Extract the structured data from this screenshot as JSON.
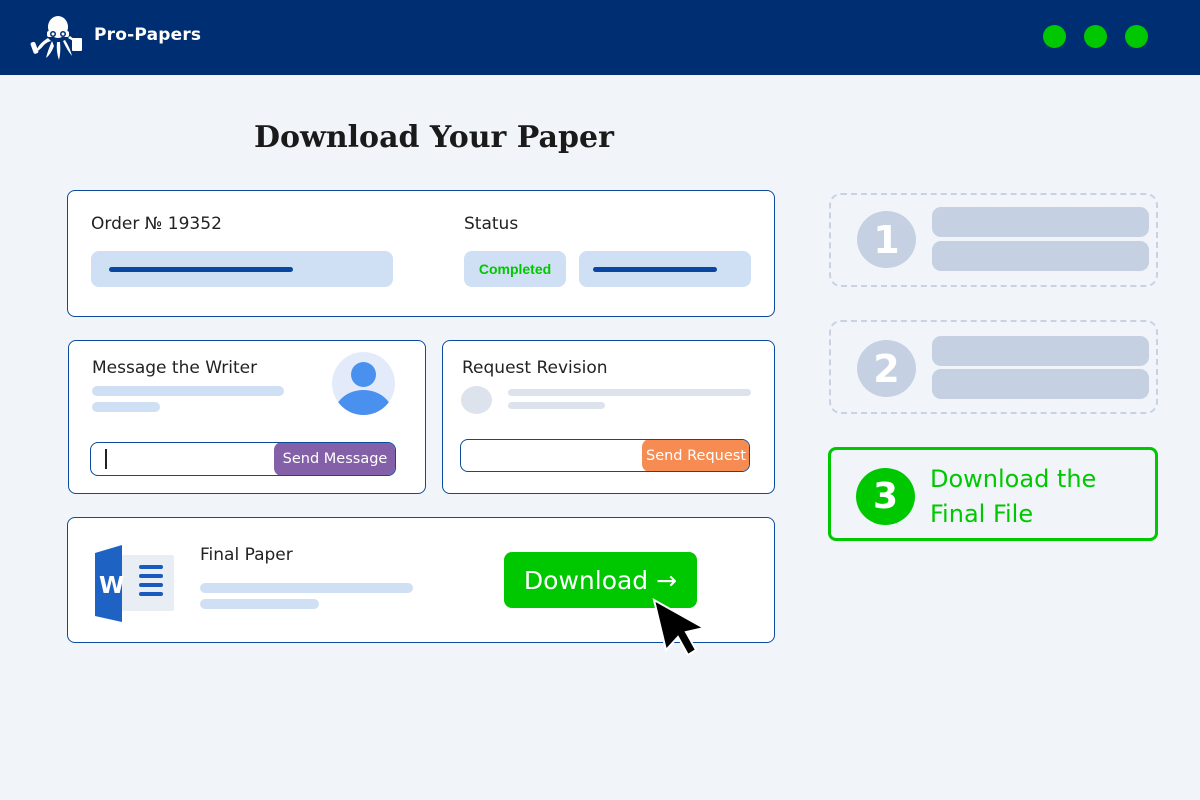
{
  "header": {
    "brand": "Pro-Papers",
    "logo_icon": "octopus-mascot-icon",
    "window_dots": [
      "#00c800",
      "#00c800",
      "#00c800"
    ]
  },
  "page": {
    "title": "Download Your Paper"
  },
  "order_card": {
    "order_label": "Order № 19352",
    "status_label": "Status",
    "status_value": "Completed"
  },
  "message_card": {
    "title": "Message the Writer",
    "input_value": "",
    "button_label": "Send Message",
    "avatar_icon": "user-avatar-icon"
  },
  "revision_card": {
    "title": "Request Revision",
    "input_value": "",
    "button_label": "Send Request"
  },
  "final_card": {
    "title": "Final Paper",
    "file_icon": "word-document-icon",
    "download_label": "Download →"
  },
  "steps": [
    {
      "number": "1",
      "state": "inactive"
    },
    {
      "number": "2",
      "state": "inactive"
    },
    {
      "number": "3",
      "state": "active",
      "label": "Download the Final File"
    }
  ],
  "colors": {
    "header_bg": "#002e73",
    "accent_green": "#00c800",
    "purple": "#8360a8",
    "orange": "#f68c52",
    "card_border": "#0b4a9c"
  }
}
